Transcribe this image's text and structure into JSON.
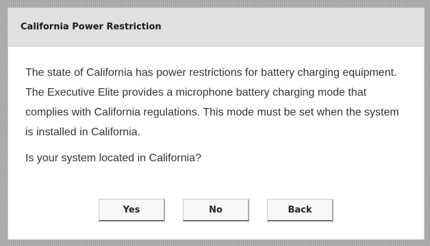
{
  "dialog": {
    "title": "California Power Restriction",
    "message": "The state of California has power restrictions for battery charging equipment. The Executive Elite provides a microphone battery charging mode that complies with California regulations. This mode must be set when the system is installed in California.",
    "question": "Is your system located in California?",
    "buttons": {
      "yes_label": "Yes",
      "no_label": "No",
      "back_label": "Back"
    }
  },
  "colors": {
    "backdrop": "#a9a9a9",
    "header_bg": "#e0e0e0",
    "dialog_bg": "#ffffff",
    "button_bg": "#f7f7f7",
    "text": "#333333"
  }
}
